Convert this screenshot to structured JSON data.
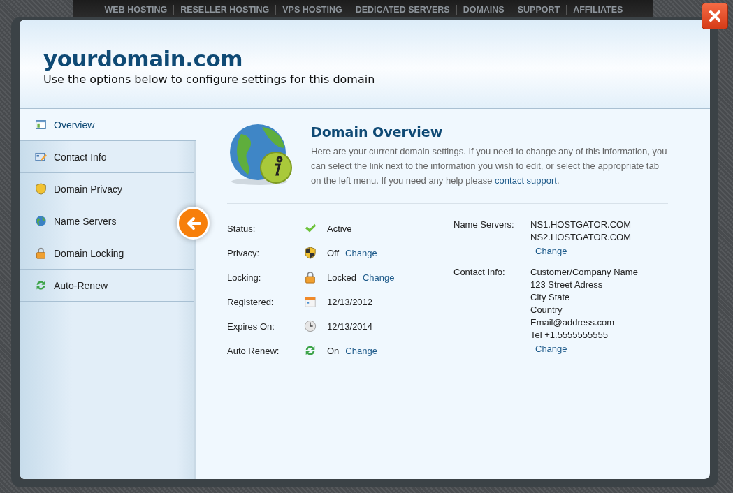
{
  "top_nav": [
    "WEB HOSTING",
    "RESELLER HOSTING",
    "VPS HOSTING",
    "DEDICATED SERVERS",
    "DOMAINS",
    "SUPPORT",
    "AFFILIATES"
  ],
  "header": {
    "title": "yourdomain.com",
    "subtitle": "Use the options below to configure settings for this domain"
  },
  "sidebar": {
    "items": [
      {
        "label": "Overview",
        "kind": "overview",
        "selected": true
      },
      {
        "label": "Contact Info",
        "kind": "contact",
        "selected": false
      },
      {
        "label": "Domain Privacy",
        "kind": "privacy",
        "selected": false
      },
      {
        "label": "Name Servers",
        "kind": "globe",
        "selected": false
      },
      {
        "label": "Domain Locking",
        "kind": "lock",
        "selected": false
      },
      {
        "label": "Auto-Renew",
        "kind": "renew",
        "selected": false
      }
    ]
  },
  "overview": {
    "title": "Domain Overview",
    "description": "Here are your current domain settings. If you need to change any of this information, you can select the link next to the information you wish to edit, or select the appropriate tab on the left menu. If you need any help please ",
    "link": "contact support",
    "after": "."
  },
  "details": [
    {
      "label": "Status:",
      "kind": "check",
      "value": "Active"
    },
    {
      "label": "Privacy:",
      "kind": "shield",
      "value": "Off",
      "link": "Change"
    },
    {
      "label": "Locking:",
      "kind": "lock",
      "value": "Locked",
      "link": "Change"
    },
    {
      "label": "Registered:",
      "kind": "calendar",
      "value": "12/13/2012"
    },
    {
      "label": "Expires On:",
      "kind": "clock",
      "value": "12/13/2014"
    },
    {
      "label": "Auto Renew:",
      "kind": "renew",
      "value": "On",
      "link": "Change"
    }
  ],
  "side_details": [
    {
      "label": "Name Servers:",
      "lines": [
        "NS1.HOSTGATOR.COM",
        "NS2.HOSTGATOR.COM"
      ],
      "link": "Change"
    },
    {
      "label": "Contact Info:",
      "lines": [
        "Customer/Company Name",
        "123 Street Adress",
        "City State",
        "Country",
        "Email@address.com",
        "Tel +1.5555555555"
      ],
      "link": "Change"
    }
  ]
}
